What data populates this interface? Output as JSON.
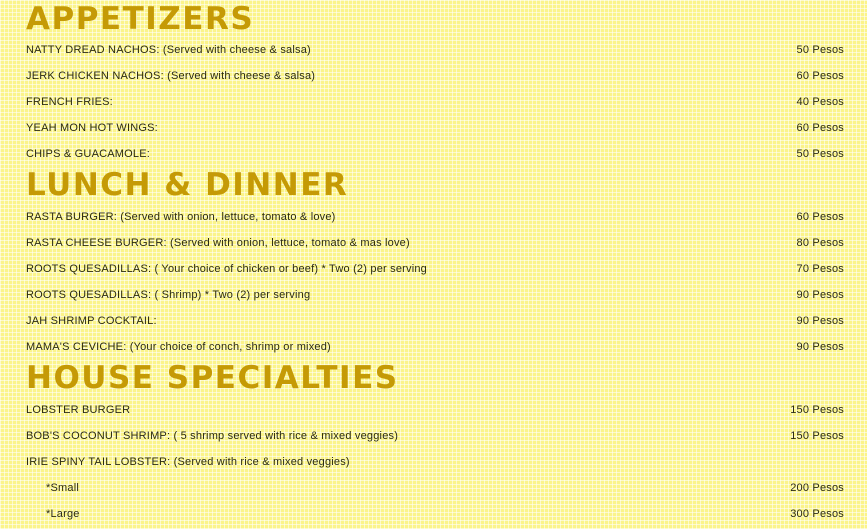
{
  "sections": [
    {
      "title": "APPETIZERS",
      "items": [
        {
          "name": "NATTY DREAD NACHOS: (Served with cheese & salsa)",
          "price": "50 Pesos"
        },
        {
          "name": "JERK CHICKEN NACHOS: (Served with cheese & salsa)",
          "price": "60 Pesos"
        },
        {
          "name": "FRENCH FRIES:",
          "price": "40 Pesos"
        },
        {
          "name": "YEAH MON HOT WINGS:",
          "price": "60 Pesos"
        },
        {
          "name": "CHIPS & GUACAMOLE:",
          "price": "50 Pesos"
        }
      ]
    },
    {
      "title": "LUNCH & DINNER",
      "items": [
        {
          "name": "RASTA BURGER: (Served with onion, lettuce, tomato & love)",
          "price": "60 Pesos"
        },
        {
          "name": "RASTA CHEESE BURGER: (Served with onion, lettuce, tomato & mas love)",
          "price": "80 Pesos"
        },
        {
          "name": "ROOTS QUESADILLAS: ( Your choice of chicken or beef) * Two (2) per serving",
          "price": "70 Pesos"
        },
        {
          "name": "ROOTS QUESADILLAS: ( Shrimp) * Two (2) per serving",
          "price": "90 Pesos"
        },
        {
          "name": "JAH SHRIMP COCKTAIL:",
          "price": "90 Pesos"
        },
        {
          "name": "MAMA'S CEVICHE: (Your choice of conch, shrimp or mixed)",
          "price": "90 Pesos"
        }
      ]
    },
    {
      "title": "HOUSE SPECIALTIES",
      "items": [
        {
          "name": "LOBSTER BURGER",
          "price": "150 Pesos"
        },
        {
          "name": "BOB'S COCONUT SHRIMP: ( 5 shrimp served with rice & mixed veggies)",
          "price": "150 Pesos"
        },
        {
          "name": "IRIE SPINY TAIL LOBSTER: (Served with rice & mixed veggies)",
          "price": ""
        },
        {
          "name": "*Small",
          "price": "200 Pesos"
        },
        {
          "name": "*Large",
          "price": "300 Pesos"
        }
      ]
    }
  ]
}
